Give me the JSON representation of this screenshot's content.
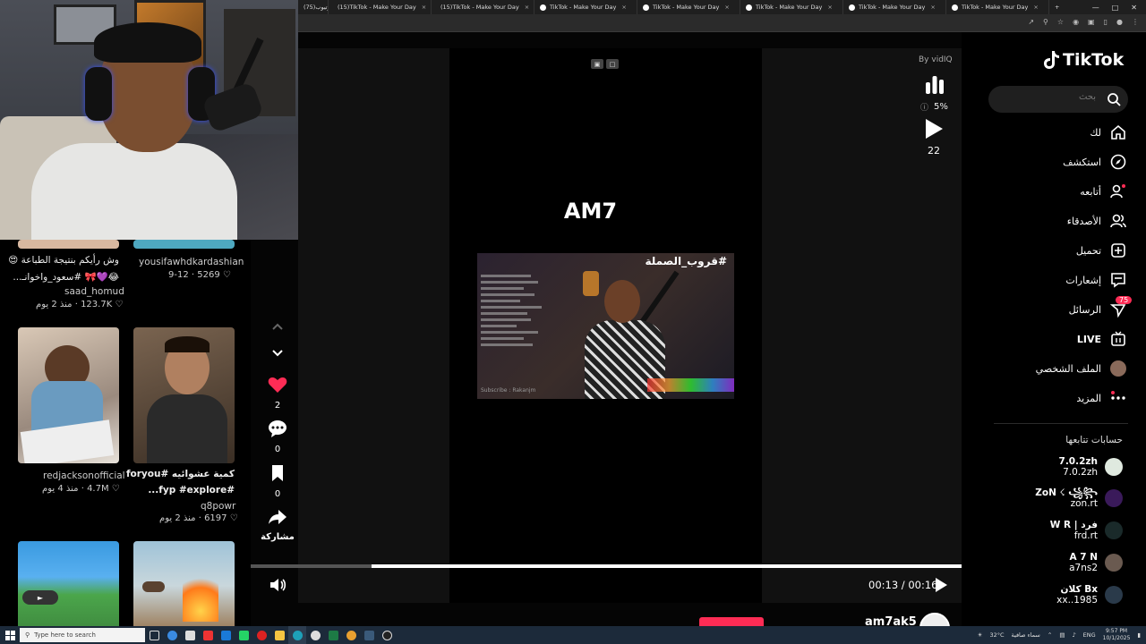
{
  "browser": {
    "tabs": [
      {
        "label": "(75)يوتيوب"
      },
      {
        "label": "(15)TikTok - Make Your Day"
      },
      {
        "label": "(15)TikTok - Make Your Day"
      },
      {
        "label": "TikTok - Make Your Day"
      },
      {
        "label": "TikTok - Make Your Day"
      },
      {
        "label": "TikTok - Make Your Day"
      },
      {
        "label": "TikTok - Make Your Day"
      },
      {
        "label": "TikTok - Make Your Day"
      }
    ],
    "new_tab": "+",
    "close_glyph": "×"
  },
  "feed": [
    {
      "caption_line1": "وش رأيكم بنتيجة الطباعة 😍",
      "caption_line2": "😂💜🎀 #سعود_واخوانـ...",
      "user": "saad_homud",
      "likes": "123.7K",
      "age": "منذ 2 يوم"
    },
    {
      "caption_line1": "",
      "caption_line2": "",
      "user": "yousifawhdkardashian",
      "likes": "5269",
      "age": "9-12"
    },
    {
      "caption_line1": "",
      "caption_line2": "",
      "user": "redjacksonofficial",
      "likes": "4.7M",
      "age": "منذ 4 يوم"
    },
    {
      "caption_line1": "كمية عشوائيه #foryou",
      "caption_line2": "#fyp #explore...",
      "user": "q8powr",
      "likes": "6197",
      "age": "منذ 2 يوم"
    }
  ],
  "video": {
    "title_overlay": "AM7",
    "inner_title": "#قروب_الصملة",
    "inner_caption": "Subscribe : Rakanjm",
    "likes": "2",
    "comments": "0",
    "saves": "0",
    "share_label": "مشاركة",
    "current_time": "00:13",
    "duration": "00:16",
    "progress": 0.17,
    "author": "am7ak5"
  },
  "vidiq": {
    "label": "By vidIQ",
    "percent": "5%",
    "views": "22"
  },
  "sidebar": {
    "logo": "TikTok",
    "search_placeholder": "بحث",
    "nav": [
      {
        "label": "لك",
        "icon": "home-icon"
      },
      {
        "label": "استكشف",
        "icon": "compass-icon"
      },
      {
        "label": "أتابعه",
        "icon": "following-icon"
      },
      {
        "label": "الأصدقاء",
        "icon": "friends-icon"
      },
      {
        "label": "تحميل",
        "icon": "upload-icon"
      },
      {
        "label": "إشعارات",
        "icon": "inbox-icon"
      },
      {
        "label": "الرسائل",
        "icon": "messages-icon",
        "badge": "75"
      },
      {
        "label": "LIVE",
        "icon": "live-icon"
      },
      {
        "label": "الملف الشخصي",
        "icon": "profile-icon"
      },
      {
        "label": "المزيد",
        "icon": "more-icon"
      }
    ],
    "following_header": "حسابات تتابعها",
    "accounts": [
      {
        "name": "7.0.2zh",
        "handle": "7.0.2zh"
      },
      {
        "name": "ZoN ☇ ꧁꧂",
        "handle": "zon.rt"
      },
      {
        "name": "W R | فرد",
        "handle": "frd.rt"
      },
      {
        "name": "A 7 N",
        "handle": "a7ns2"
      },
      {
        "name": "كلان Bx",
        "handle": "xx..1985"
      }
    ],
    "brand_color": "#fe2c55"
  },
  "taskbar": {
    "search_placeholder": "Type here to search",
    "weather": "32°C",
    "weather_text": "سماء صافية",
    "lang": "ENG",
    "time": "9:57 PM",
    "date": "10/1/2025"
  }
}
